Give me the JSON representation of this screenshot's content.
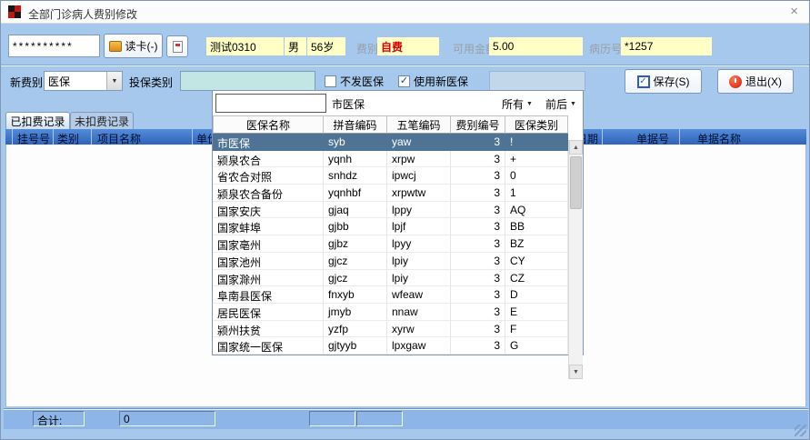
{
  "window": {
    "title": "全部门诊病人费别修改"
  },
  "icons": {
    "close": "×",
    "dropdown_arrow": "▼",
    "scroll_up": "▲",
    "scroll_down": "▼",
    "check": "✓"
  },
  "toolbar": {
    "password_value": "**********",
    "read_card_label": "读卡(-)",
    "patient_name": "测试0310",
    "patient_gender": "男",
    "patient_age": "56岁",
    "fee_type_label": "费别",
    "fee_type_value": "自费",
    "available_amount_label": "可用金额",
    "available_amount_value": "5.00",
    "record_no_label": "病历号",
    "record_no_value": "*1257"
  },
  "controls": {
    "new_fee_label": "新费别",
    "new_fee_value": "医保",
    "insure_type_label": "投保类别",
    "insure_type_value": "",
    "checkbox_no_send_label": "不发医保",
    "checkbox_no_send_checked": false,
    "checkbox_use_new_label": "使用新医保",
    "checkbox_use_new_checked": true,
    "disabled_field_value": "",
    "save_label": "保存(S)",
    "exit_label": "退出(X)"
  },
  "popup": {
    "search_value": "",
    "selected_name": "市医保",
    "filter_all_label": "所有",
    "filter_order_label": "前后",
    "columns": [
      "医保名称",
      "拼音编码",
      "五笔编码",
      "费别编号",
      "医保类别"
    ],
    "selected_index": 0,
    "rows": [
      [
        "市医保",
        "syb",
        "yaw",
        "3",
        "!"
      ],
      [
        "颍泉农合",
        "yqnh",
        "xrpw",
        "3",
        "+"
      ],
      [
        "省农合对照",
        "snhdz",
        "ipwcj",
        "3",
        "0"
      ],
      [
        "颍泉农合备份",
        "yqnhbf",
        "xrpwtw",
        "3",
        "1"
      ],
      [
        "国家安庆",
        "gjaq",
        "lppy",
        "3",
        "AQ"
      ],
      [
        "国家蚌埠",
        "gjbb",
        "lpjf",
        "3",
        "BB"
      ],
      [
        "国家亳州",
        "gjbz",
        "lpyy",
        "3",
        "BZ"
      ],
      [
        "国家池州",
        "gjcz",
        "lpiy",
        "3",
        "CY"
      ],
      [
        "国家滁州",
        "gjcz",
        "lpiy",
        "3",
        "CZ"
      ],
      [
        "阜南县医保",
        "fnxyb",
        "wfeaw",
        "3",
        "D"
      ],
      [
        "居民医保",
        "jmyb",
        "nnaw",
        "3",
        "E"
      ],
      [
        "颍州扶贫",
        "yzfp",
        "xyrw",
        "3",
        "F"
      ],
      [
        "国家统一医保",
        "gjtyyb",
        "lpxgaw",
        "3",
        "G"
      ]
    ]
  },
  "tabs": [
    {
      "label": "已扣费记录",
      "active": true
    },
    {
      "label": "未扣费记录",
      "active": false
    }
  ],
  "grid": {
    "columns": [
      "挂号号",
      "类别",
      "项目名称",
      "单价",
      "日期",
      "单据号",
      "单据名称"
    ]
  },
  "footer": {
    "total_label": "合计:",
    "total_value": "0"
  }
}
